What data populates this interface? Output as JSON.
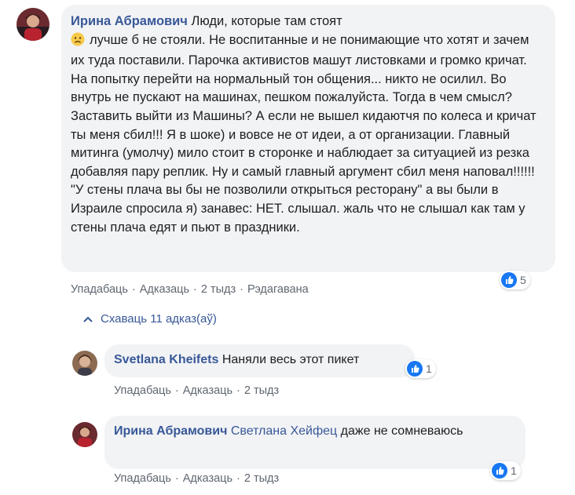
{
  "comment": {
    "author": "Ирина Абрамович",
    "text_first": "Люди, которые там стоят",
    "text_rest": "лучше б не стояли. Не воспитанные и не понимающие что хотят и зачем их туда поставили. Парочка активистов машут листовками и громко кричат. На попытку перейти на нормальный тон общения... никто не осилил. Во внутрь не пускают на машинах, пешком пожалуйста. Тогда в чем смысл? Заставить выйти из Машины? А если не вышел кидаютчя по колеса и кричат ты меня сбил!!! Я в шоке) и вовсе не от идеи, а от организации. Главный митинга (умолчу) мило стоит в сторонке и наблюдает за ситуацией из резка добавляя пару реплик. Ну и самый главный аргумент сбил меня наповал!!!!!! \"У стены плача вы бы не позволили открыться ресторану\" а вы были в Израиле спросила я) занавес: НЕТ. слышал. жаль что не слышал как там у стены плача едят и пьют в праздники.",
    "emoji": "sad-face-icon",
    "actions": {
      "like": "Упадабаць",
      "reply": "Адказаць",
      "time": "2 тыдз",
      "edited": "Рэдагавана"
    },
    "reactions": "5"
  },
  "replies_toggle": "Схаваць 11 адказ(аў)",
  "replies": [
    {
      "author": "Svetlana Kheifets",
      "text": "Наняли весь этот пикет",
      "actions": {
        "like": "Упадабаць",
        "reply": "Адказаць",
        "time": "2 тыдз"
      },
      "reactions": "1"
    },
    {
      "author": "Ирина Абрамович",
      "mention": "Светлана Хейфец",
      "text": "даже не сомневаюсь",
      "actions": {
        "like": "Упадабаць",
        "reply": "Адказаць",
        "time": "2 тыдз"
      },
      "reactions": "1"
    }
  ],
  "colors": {
    "link": "#385898",
    "bubble": "#f2f3f5",
    "like_blue": "#1877f2",
    "meta": "#606770"
  }
}
